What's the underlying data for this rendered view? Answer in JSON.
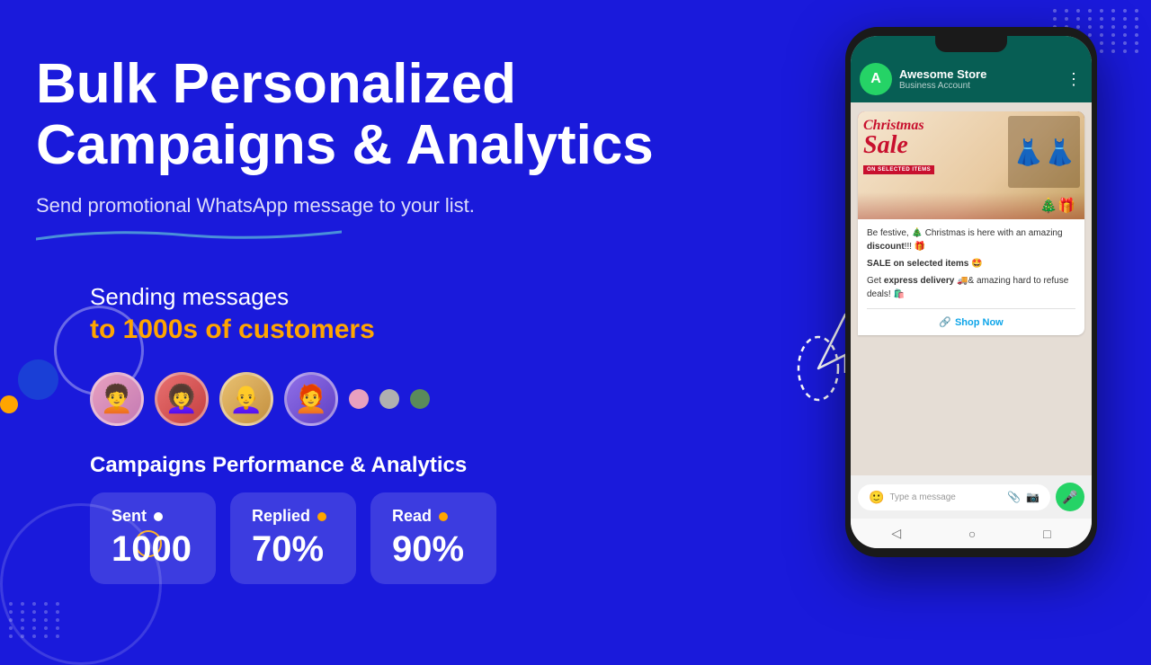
{
  "hero": {
    "headline_line1": "Bulk Personalized",
    "headline_line2": "Campaigns & Analytics",
    "subtitle": "Send promotional WhatsApp message to your list.",
    "sending_line1": "Sending messages",
    "sending_line2": "to 1000s of customers",
    "analytics_title": "Campaigns Performance & Analytics"
  },
  "stats": [
    {
      "label": "Sent",
      "value": "1000"
    },
    {
      "label": "Replied",
      "value": "70%"
    },
    {
      "label": "Read",
      "value": "90%"
    }
  ],
  "whatsapp": {
    "business_name": "Awesome Store",
    "account_type": "Business Account",
    "avatar_letter": "A",
    "image_text1": "Christmas",
    "image_text2": "Sale",
    "image_subtitle": "ON SELECTED ITEMS",
    "message_line1": "Be festive, 🎄 Christmas is here with an amazing",
    "message_bold1": "discount",
    "message_line1b": "!!! 🎁",
    "sale_line": "SALE on selected items 🤩",
    "delivery_line1": "Get",
    "delivery_bold": "express delivery",
    "delivery_line2": "🚚& amazing hard to refuse deals! 🛍️",
    "shop_button": "Shop Now",
    "input_placeholder": "Type a message"
  }
}
